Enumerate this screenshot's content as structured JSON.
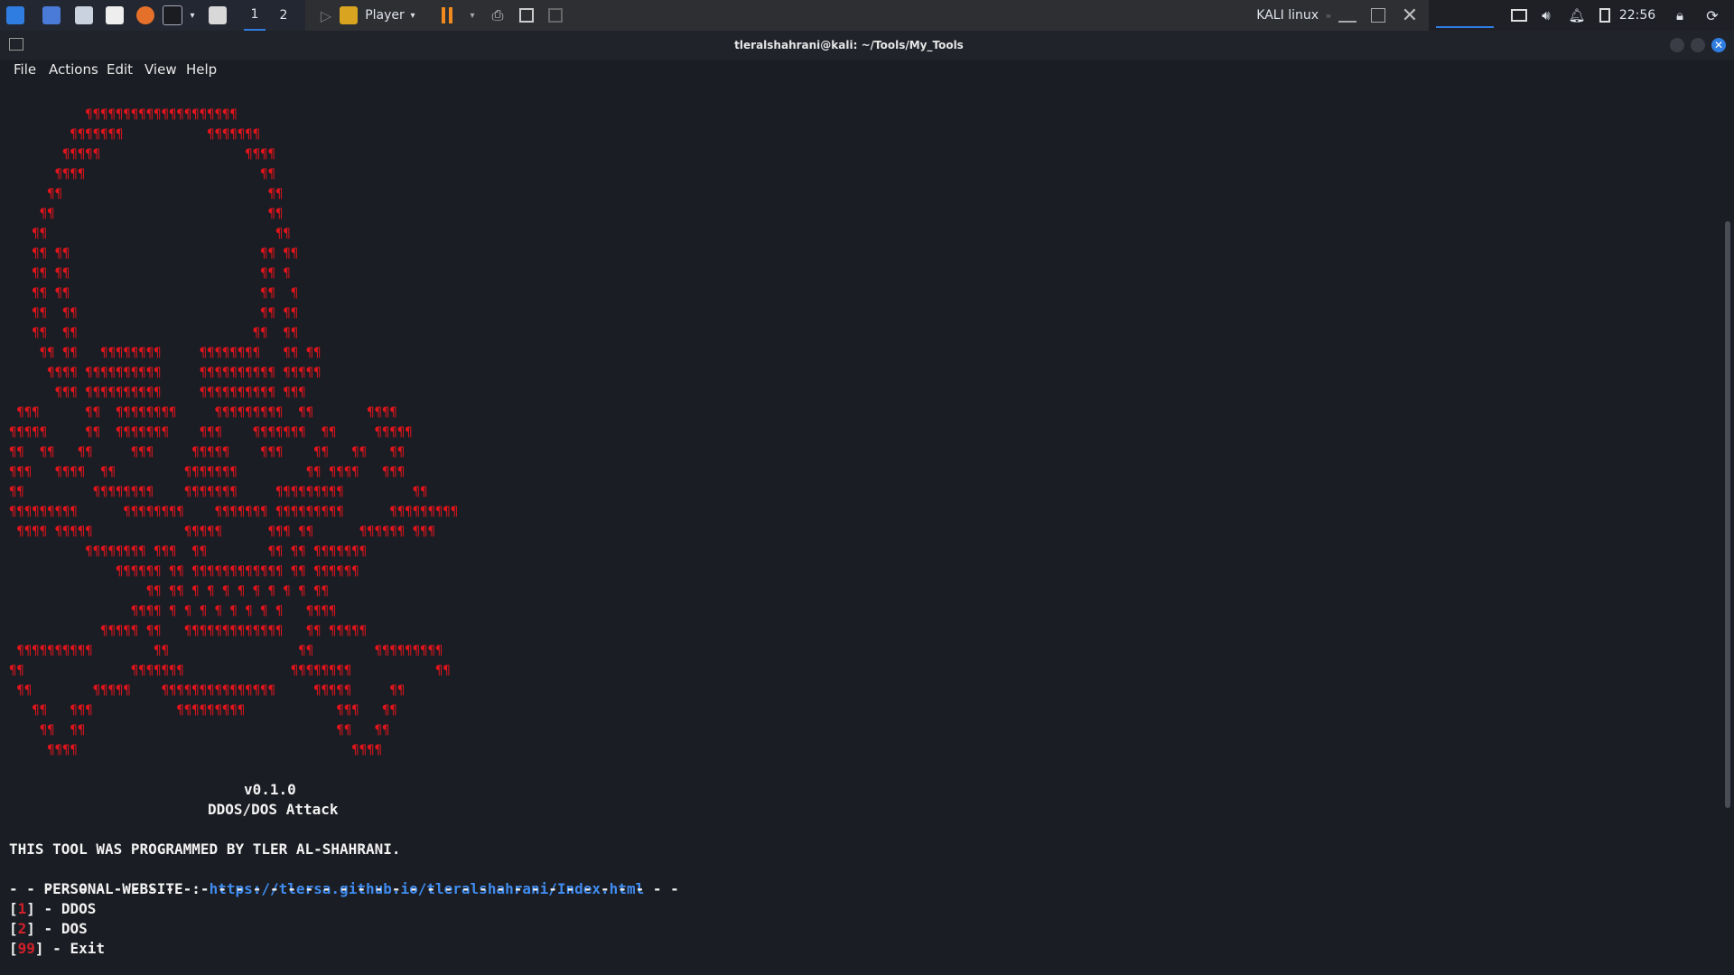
{
  "taskbar": {
    "workspaces": [
      "1",
      "2"
    ],
    "player_label": "Player",
    "vm_name": "KALI linux",
    "clock": "22:56"
  },
  "window": {
    "title": "tleralshahrani@kali: ~/Tools/My_Tools"
  },
  "menu": [
    "File",
    "Actions",
    "Edit",
    "View",
    "Help"
  ],
  "banner": {
    "art": "          ¶¶¶¶¶¶¶¶¶¶¶¶¶¶¶¶¶¶¶¶\n        ¶¶¶¶¶¶¶           ¶¶¶¶¶¶¶\n       ¶¶¶¶¶                   ¶¶¶¶\n      ¶¶¶¶                       ¶¶\n     ¶¶                           ¶¶\n    ¶¶                            ¶¶\n   ¶¶                              ¶¶\n   ¶¶ ¶¶                         ¶¶ ¶¶\n   ¶¶ ¶¶                         ¶¶ ¶\n   ¶¶ ¶¶                         ¶¶  ¶\n   ¶¶  ¶¶                        ¶¶ ¶¶\n   ¶¶  ¶¶                       ¶¶  ¶¶\n    ¶¶ ¶¶   ¶¶¶¶¶¶¶¶     ¶¶¶¶¶¶¶¶   ¶¶ ¶¶\n     ¶¶¶¶ ¶¶¶¶¶¶¶¶¶¶     ¶¶¶¶¶¶¶¶¶¶ ¶¶¶¶¶\n      ¶¶¶ ¶¶¶¶¶¶¶¶¶¶     ¶¶¶¶¶¶¶¶¶¶ ¶¶¶\n ¶¶¶      ¶¶  ¶¶¶¶¶¶¶¶     ¶¶¶¶¶¶¶¶¶  ¶¶       ¶¶¶¶\n¶¶¶¶¶     ¶¶  ¶¶¶¶¶¶¶    ¶¶¶    ¶¶¶¶¶¶¶  ¶¶     ¶¶¶¶¶\n¶¶  ¶¶   ¶¶     ¶¶¶     ¶¶¶¶¶    ¶¶¶    ¶¶   ¶¶   ¶¶\n¶¶¶   ¶¶¶¶  ¶¶         ¶¶¶¶¶¶¶         ¶¶ ¶¶¶¶   ¶¶¶\n¶¶         ¶¶¶¶¶¶¶¶    ¶¶¶¶¶¶¶     ¶¶¶¶¶¶¶¶¶         ¶¶\n¶¶¶¶¶¶¶¶¶      ¶¶¶¶¶¶¶¶    ¶¶¶¶¶¶¶ ¶¶¶¶¶¶¶¶¶      ¶¶¶¶¶¶¶¶¶\n ¶¶¶¶ ¶¶¶¶¶            ¶¶¶¶¶      ¶¶¶ ¶¶      ¶¶¶¶¶¶ ¶¶¶\n          ¶¶¶¶¶¶¶¶ ¶¶¶  ¶¶        ¶¶ ¶¶ ¶¶¶¶¶¶¶\n              ¶¶¶¶¶¶ ¶¶ ¶¶¶¶¶¶¶¶¶¶¶¶ ¶¶ ¶¶¶¶¶¶\n                  ¶¶ ¶¶ ¶ ¶ ¶ ¶ ¶ ¶ ¶ ¶ ¶¶\n                ¶¶¶¶ ¶ ¶ ¶ ¶ ¶ ¶ ¶ ¶   ¶¶¶¶\n            ¶¶¶¶¶ ¶¶   ¶¶¶¶¶¶¶¶¶¶¶¶¶   ¶¶ ¶¶¶¶¶\n ¶¶¶¶¶¶¶¶¶¶        ¶¶                 ¶¶        ¶¶¶¶¶¶¶¶¶\n¶¶              ¶¶¶¶¶¶¶              ¶¶¶¶¶¶¶¶           ¶¶\n ¶¶        ¶¶¶¶¶    ¶¶¶¶¶¶¶¶¶¶¶¶¶¶¶     ¶¶¶¶¶     ¶¶\n   ¶¶   ¶¶¶           ¶¶¶¶¶¶¶¶¶            ¶¶¶   ¶¶\n    ¶¶  ¶¶                                 ¶¶   ¶¶\n     ¶¶¶¶                                    ¶¶¶¶",
    "version": "v0.1.0",
    "subtitle": "DDOS/DOS Attack"
  },
  "info": {
    "author_line": "THIS TOOL WAS PROGRAMMED BY TLER AL-SHAHRANI.",
    "website_label": "PERSONAL WEBSITE : ",
    "website_url": "https://tlersa.github.io/tleralshahrani/Index.html",
    "separator": "- - - - - - - - - - - - - - - - - - - - - - - - - - - - - - - - - - - - - - -"
  },
  "options": [
    {
      "num": "1",
      "label": "] - DDOS"
    },
    {
      "num": "2",
      "label": "] - DOS"
    },
    {
      "num": "99",
      "label": "] - Exit"
    }
  ],
  "colors": {
    "accent": "#e1141c",
    "link": "#3f8cf0",
    "background": "#1b1d24"
  }
}
